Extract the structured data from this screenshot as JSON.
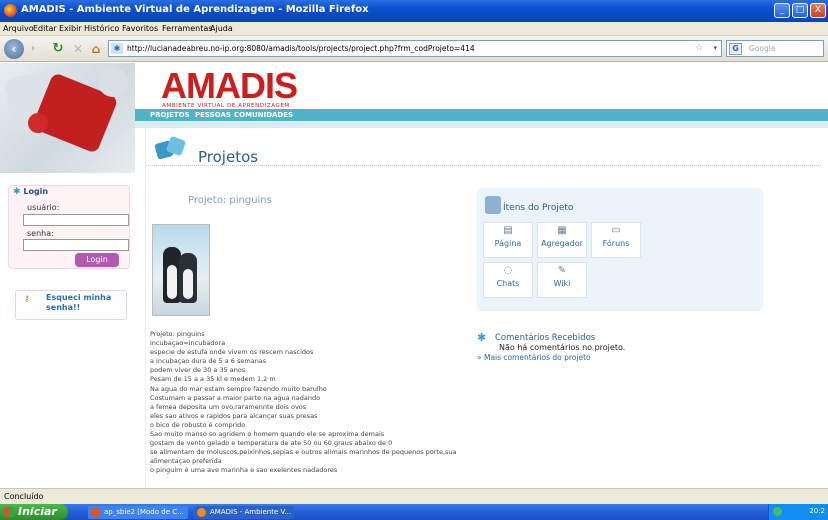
{
  "window": {
    "title": "AMADIS - Ambiente Virtual de Aprendizagem - Mozilla Firefox",
    "min": "_",
    "max": "□",
    "close": "X"
  },
  "menu": [
    "Arquivo",
    "Editar",
    "Exibir",
    "Histórico",
    "Favoritos",
    "Ferramentas",
    "Ajuda"
  ],
  "nav": {
    "url": "http://lucianadeabreu.no-ip.org:8080/amadis/tools/projects/project.php?frm_codProjeto=414",
    "search_placeholder": "Google"
  },
  "site": {
    "logo": "AMADIS",
    "logo_sub": "AMBIENTE VIRTUAL DE APRENDIZAGEM",
    "nav_items": [
      "PROJETOS",
      "PESSOAS",
      "COMUNIDADES"
    ]
  },
  "login": {
    "title": "Login",
    "user_label": "usuário:",
    "pass_label": "senha:",
    "button": "Login",
    "forgot": "Esqueci minha senha!!"
  },
  "main": {
    "page_title": "Projetos",
    "project_title": "Projeto: pinguins",
    "text_lines": [
      "Projeto: pinguins",
      "incubaçao=incubadora",
      "especie de estufa onde vivem os rescem nascidos",
      "a incubaçao dura de 5 a 6 semanas",
      "podem viver de 30 a 35 anos",
      "Pesam de 15 a a 35 kl e medem 1,2 m",
      "Na agua do mar estam sempre fazendo muito barulho",
      "Costumam a passar a maior parte na agua nadando",
      "a femea deposita um ovo,raramennte dois ovos",
      "eles sao ativos e rapidos para alcançar suas presas",
      "o bico de robusto é comprido",
      "Sao muito manso so agridem o homem quando ele se aproxima demais",
      "gostam de vento gelado e temperatura de ate 50 ou 60 graus abaixo de 0",
      "se alimentam de moluscos,peixinhos,sepias e outros alimais marinhos de pequenos porte,sua",
      "alimentaçao preferida",
      "o pinguim é uma ave marinha e sao exelentes nadadores"
    ]
  },
  "itens": {
    "title": "Ítens do Projeto",
    "items": [
      {
        "label": "Página",
        "icon": "page-icon"
      },
      {
        "label": "Agregador",
        "icon": "aggregator-icon"
      },
      {
        "label": "Fóruns",
        "icon": "forum-icon"
      },
      {
        "label": "Chats",
        "icon": "chat-icon"
      },
      {
        "label": "Wiki",
        "icon": "wiki-icon"
      }
    ]
  },
  "comments": {
    "title": "Comentários Recebidos",
    "message": "Não há comentários no projeto.",
    "link": "» Mais comentários do projeto"
  },
  "status": {
    "text": "Concluído"
  },
  "taskbar": {
    "start": "Iniciar",
    "tasks": [
      "ap_sbie2 [Modo de C...",
      "AMADIS - Ambiente V..."
    ],
    "clock": "20:2"
  },
  "colors": {
    "accent_teal": "#4eb5c9",
    "logo_red": "#cf1c1c",
    "link_blue": "#2a5e98",
    "login_purple": "#b05ab0"
  }
}
